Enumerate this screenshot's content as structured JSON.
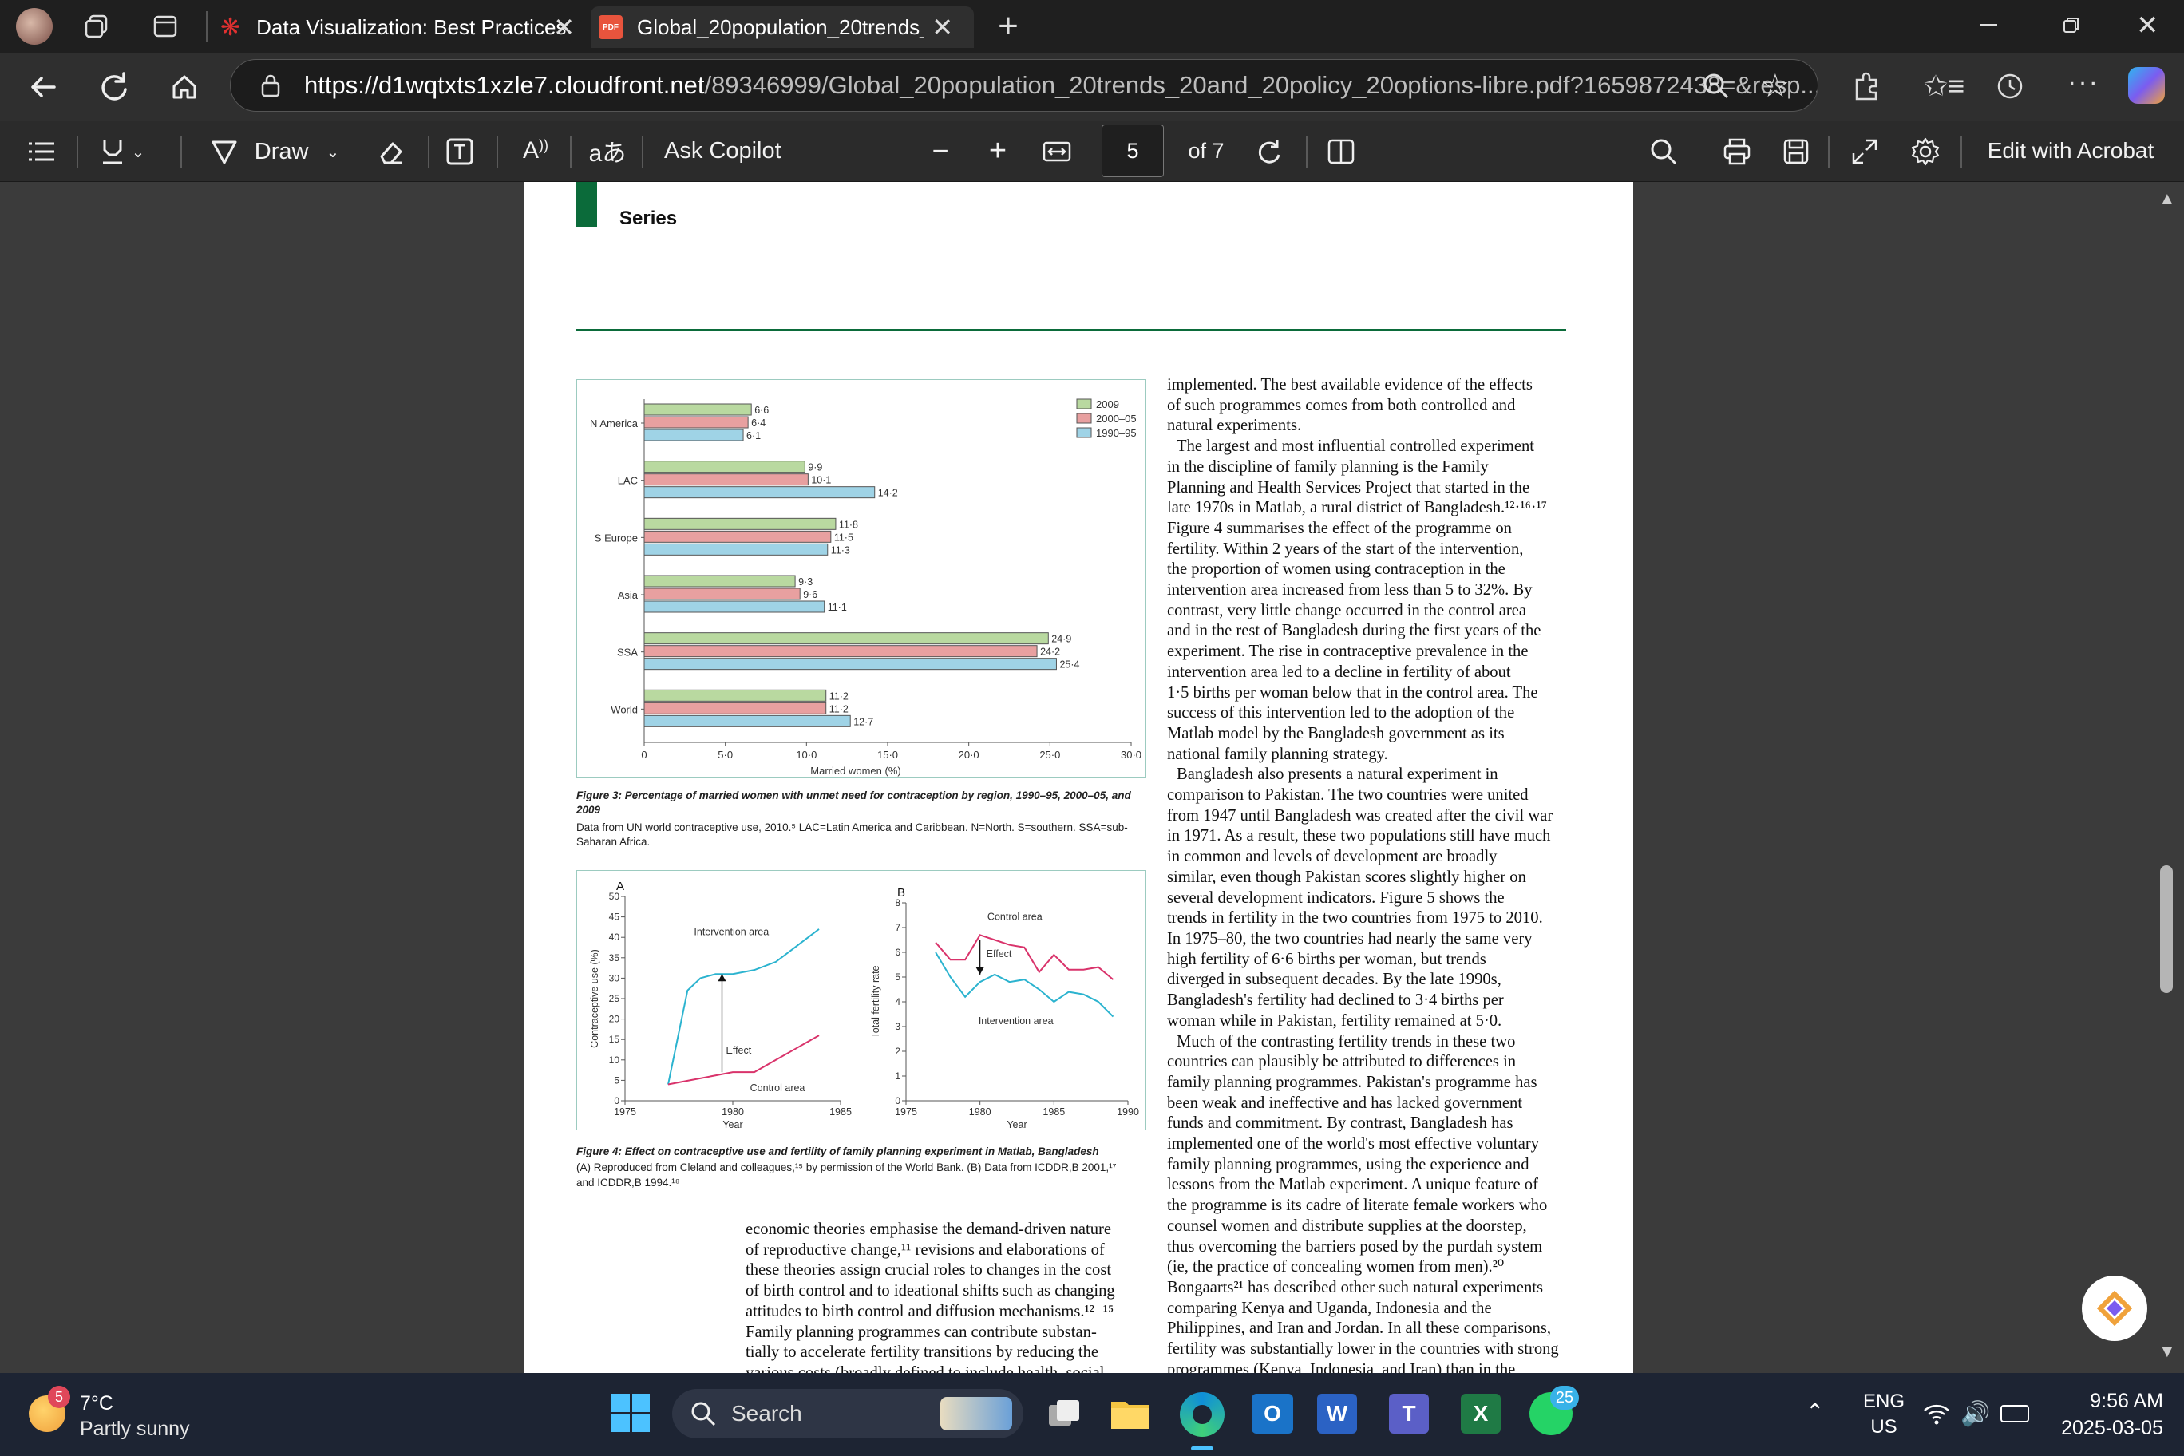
{
  "browser": {
    "tabs": [
      {
        "label": "Data Visualization: Best Practices",
        "active": false
      },
      {
        "label": "Global_20population_20trends_20",
        "active": true
      }
    ],
    "new_tab_icon": "plus-icon",
    "url_host": "https://d1wqtxts1xzle7.cloudfront.net",
    "url_path": "/89346999/Global_20population_20trends_20and_20policy_20options-libre.pdf?1659872438=&resp..."
  },
  "pdf_toolbar": {
    "draw_label": "Draw",
    "ask_copilot": "Ask Copilot",
    "page_current": "5",
    "page_total": "of 7",
    "edit_acrobat": "Edit with Acrobat",
    "aa_label": "A",
    "translate_label": "aあ"
  },
  "document": {
    "section_label": "Series",
    "figure3": {
      "caption_title": "Figure 3: Percentage of married women with unmet need for contraception by region, 1990–95, 2000–05, and 2009",
      "caption_note": "Data from UN world contraceptive use, 2010.⁵ LAC=Latin America and Caribbean. N=North. S=southern. SSA=sub-Saharan Africa."
    },
    "figure4": {
      "caption_title": "Figure 4: Effect on contraceptive use and fertility of family planning experiment in Matlab, Bangladesh",
      "caption_note_1": "(A) Reproduced from Cleland and colleagues,¹⁵ by permission of the World Bank. (B) Data from ICDDR,B 2001,¹⁷",
      "caption_note_2": "and ICDDR,B 1994.¹⁸"
    },
    "left_column": [
      "economic theories emphasise the demand-driven nature",
      "of reproductive change,¹¹ revisions and elaborations of",
      "these theories assign crucial roles to changes in the cost",
      "of birth control and to ideational shifts such as changing",
      "attitudes to birth control and diffusion mechanisms.¹²⁻¹⁵",
      "Family planning programmes can contribute substan-",
      "tially to accelerate fertility transitions by reducing the",
      "various costs (broadly defined to include health, social"
    ],
    "right_column": [
      "implemented. The best available evidence of the effects",
      "of such programmes comes from both controlled and",
      "natural experiments.",
      "The largest and most influential controlled experiment",
      "in the discipline of family planning is the Family",
      "Planning and Health Services Project that started in the",
      "late 1970s in Matlab, a rural district of Bangladesh.¹²·¹⁶·¹⁷",
      "Figure 4 summarises the effect of the programme on",
      "fertility. Within 2 years of the start of the intervention,",
      "the proportion of women using contraception in the",
      "intervention area increased from less than 5 to 32%. By",
      "contrast, very little change occurred in the control area",
      "and in the rest of Bangladesh during the first years of the",
      "experiment. The rise in contraceptive prevalence in the",
      "intervention area led to a decline in fertility of about",
      "1·5 births per woman below that in the control area. The",
      "success of this intervention led to the adoption of the",
      "Matlab model by the Bangladesh government as its",
      "national family planning strategy.",
      "Bangladesh also presents a natural experiment in",
      "comparison to Pakistan. The two countries were united",
      "from 1947 until Bangladesh was created after the civil war",
      "in 1971. As a result, these two populations still have much",
      "in common and levels of development are broadly",
      "similar, even though Pakistan scores slightly higher on",
      "several development indicators. Figure 5 shows the",
      "trends in fertility in the two countries from 1975 to 2010.",
      "In 1975–80, the two countries had nearly the same very",
      "high fertility of 6·6 births per woman, but trends",
      "diverged in subsequent decades. By the late 1990s,",
      "Bangladesh's fertility had declined to 3·4 births per",
      "woman while in Pakistan, fertility remained at 5·0.",
      "Much of the contrasting fertility trends in these two",
      "countries can plausibly be attributed to differences in",
      "family planning programmes. Pakistan's programme has",
      "been weak and ineffective and has lacked government",
      "funds and commitment. By contrast, Bangladesh has",
      "implemented one of the world's most effective voluntary",
      "family planning programmes, using the experience and",
      "lessons from the Matlab experiment. A unique feature of",
      "the programme is its cadre of literate female workers who",
      "counsel women and distribute supplies at the doorstep,",
      "thus overcoming the barriers posed by the purdah system",
      "(ie, the practice of concealing women from men).²⁰",
      "Bongaarts²¹ has described other such natural experiments",
      "comparing Kenya and Uganda, Indonesia and the",
      "Philippines, and Iran and Jordan. In all these comparisons,",
      "fertility was substantially lower in the countries with strong",
      "programmes (Kenya, Indonesia, and Iran) than in the"
    ]
  },
  "chart_data": [
    {
      "type": "bar",
      "orientation": "horizontal",
      "categories": [
        "N America",
        "LAC",
        "S Europe",
        "Asia",
        "SSA",
        "World"
      ],
      "series": [
        {
          "name": "2009",
          "color": "#b9d9a0",
          "values": [
            6.6,
            9.9,
            11.8,
            9.3,
            24.9,
            11.2
          ],
          "labels": [
            "6·6",
            "9·9",
            "11·8",
            "9·3",
            "24·9",
            "11·2"
          ]
        },
        {
          "name": "2000–05",
          "color": "#e8a0a0",
          "values": [
            6.4,
            10.1,
            11.5,
            9.6,
            24.2,
            11.2
          ],
          "labels": [
            "6·4",
            "10·1",
            "11·5",
            "9·6",
            "24·2",
            "11·2"
          ]
        },
        {
          "name": "1990–95",
          "color": "#9fd3e6",
          "values": [
            6.1,
            14.2,
            11.3,
            11.1,
            25.4,
            12.7
          ],
          "labels": [
            "6·1",
            "14·2",
            "11·3",
            "11·1",
            "25·4",
            "12·7"
          ]
        }
      ],
      "xlabel": "Married women (%)",
      "xlim": [
        0,
        30
      ],
      "ticks": [
        0,
        5,
        10,
        15,
        20,
        25,
        30
      ],
      "tick_labels": [
        "0",
        "5·0",
        "10·0",
        "15·0",
        "20·0",
        "25·0",
        "30·0"
      ],
      "legend": "top-right"
    },
    {
      "type": "line",
      "panel": "A",
      "xlabel": "Year",
      "ylabel": "Contraceptive use (%)",
      "xlim": [
        1975,
        1985
      ],
      "ylim": [
        0,
        50
      ],
      "xticks": [
        1975,
        1980,
        1985
      ],
      "yticks": [
        0,
        5,
        10,
        15,
        20,
        25,
        30,
        35,
        40,
        45,
        50
      ],
      "series": [
        {
          "name": "Intervention area",
          "color": "#2bb3cf",
          "x": [
            1977,
            1977.9,
            1978.5,
            1979.2,
            1980,
            1981,
            1982,
            1983,
            1984
          ],
          "y": [
            4,
            27,
            30,
            31,
            31,
            32,
            34,
            38,
            42
          ]
        },
        {
          "name": "Control area",
          "color": "#d9336b",
          "x": [
            1977,
            1978,
            1979,
            1980,
            1981,
            1982,
            1983,
            1984
          ],
          "y": [
            4,
            5,
            6,
            7,
            7,
            10,
            13,
            16
          ]
        }
      ],
      "annotations": [
        "Effect"
      ]
    },
    {
      "type": "line",
      "panel": "B",
      "xlabel": "Year",
      "ylabel": "Total fertility rate",
      "xlim": [
        1975,
        1990
      ],
      "ylim": [
        0,
        8
      ],
      "xticks": [
        1975,
        1980,
        1985,
        1990
      ],
      "yticks": [
        0,
        1,
        2,
        3,
        4,
        5,
        6,
        7,
        8
      ],
      "series": [
        {
          "name": "Control area",
          "color": "#d9336b",
          "x": [
            1977,
            1978,
            1979,
            1980,
            1981,
            1982,
            1983,
            1984,
            1985,
            1986,
            1987,
            1988,
            1989
          ],
          "y": [
            6.4,
            5.7,
            5.7,
            6.7,
            6.5,
            6.3,
            6.2,
            5.2,
            5.9,
            5.3,
            5.3,
            5.4,
            4.9
          ]
        },
        {
          "name": "Intervention area",
          "color": "#2bb3cf",
          "x": [
            1977,
            1978,
            1979,
            1980,
            1981,
            1982,
            1983,
            1984,
            1985,
            1986,
            1987,
            1988,
            1989
          ],
          "y": [
            6.0,
            5.0,
            4.2,
            4.8,
            5.1,
            4.8,
            4.9,
            4.5,
            4.0,
            4.4,
            4.3,
            4.0,
            3.4
          ]
        }
      ],
      "annotations": [
        "Effect"
      ]
    }
  ],
  "taskbar": {
    "weather_temp": "7°C",
    "weather_desc": "Partly sunny",
    "weather_badge": "5",
    "search_label": "Search",
    "whatsapp_badge": "25",
    "lang_1": "ENG",
    "lang_2": "US",
    "time": "9:56 AM",
    "date": "2025-03-05"
  }
}
